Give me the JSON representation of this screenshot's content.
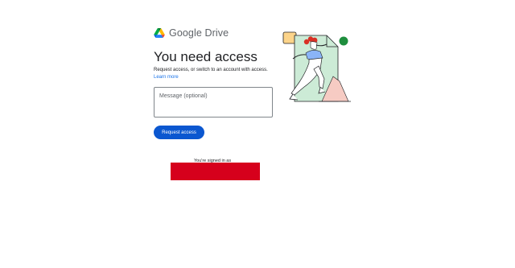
{
  "brand": {
    "name": "Google Drive",
    "logo_icon": "google-drive-icon"
  },
  "page": {
    "title": "You need access",
    "description": "Request access, or switch to an account with access.",
    "learn_more": "Learn more"
  },
  "form": {
    "message_placeholder": "Message (optional)",
    "message_value": "",
    "request_button": "Request access"
  },
  "account": {
    "signed_in_label": "You're signed in as"
  },
  "colors": {
    "primary_button": "#0b57d0",
    "link": "#1a73e8",
    "redaction": "#d6001c"
  }
}
